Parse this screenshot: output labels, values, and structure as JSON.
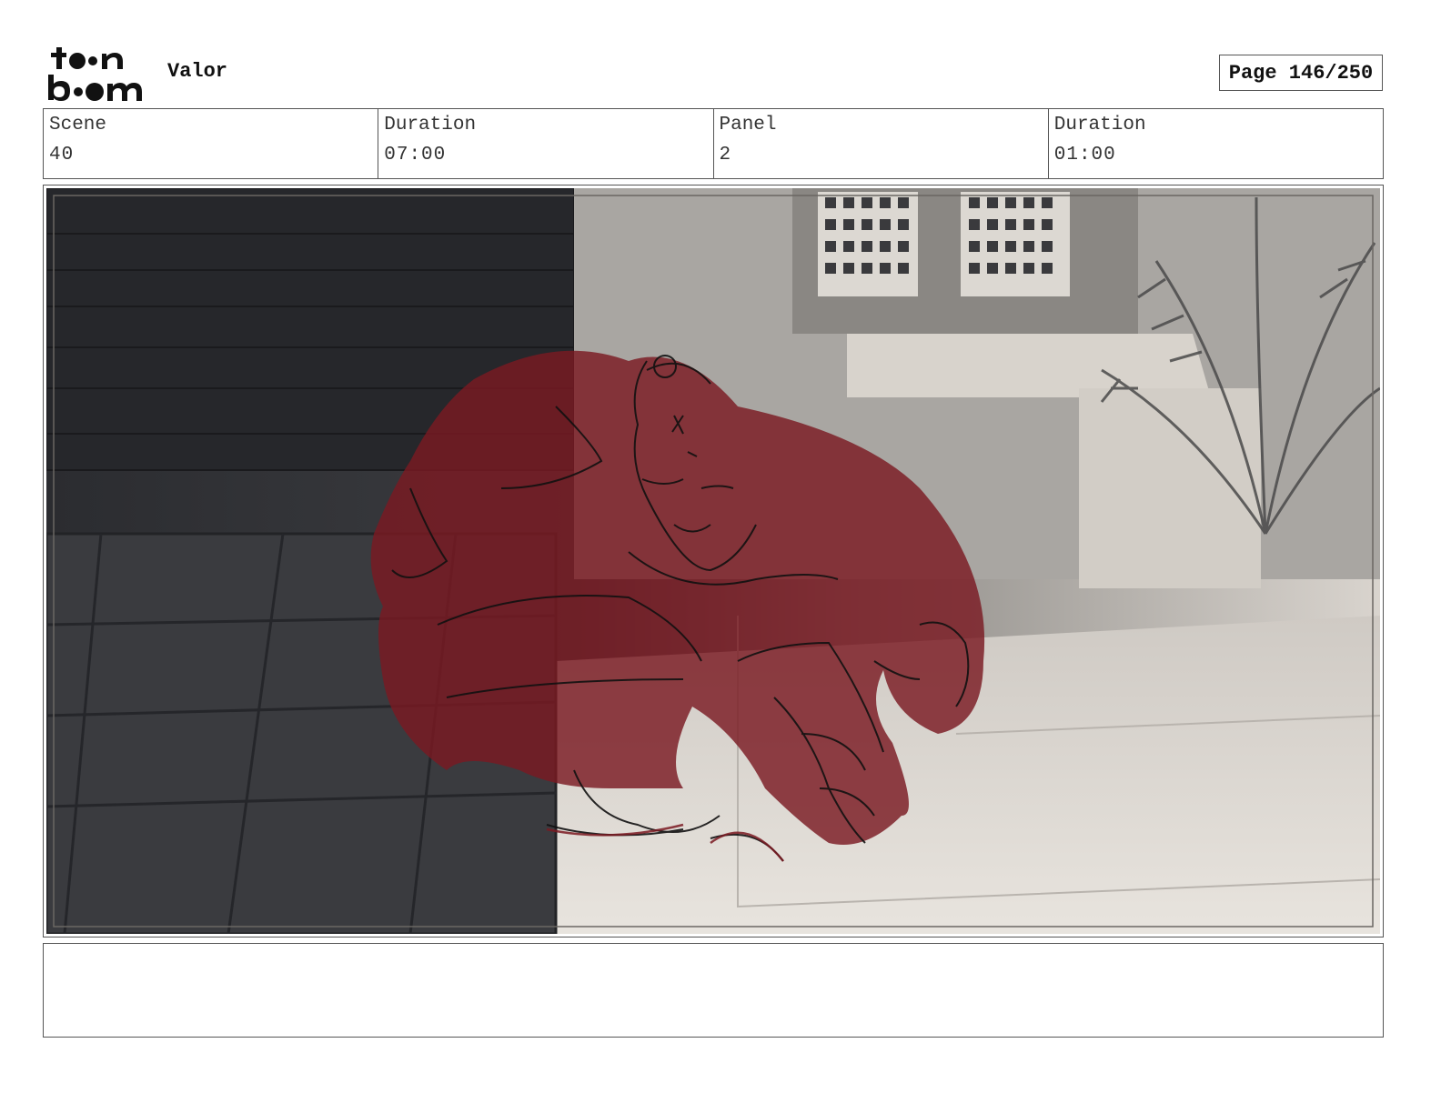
{
  "header": {
    "logo_text": "toon boom",
    "project_title": "Valor",
    "page_label": "Page 146/250"
  },
  "info": {
    "scene_label": "Scene",
    "scene_value": "40",
    "scene_duration_label": "Duration",
    "scene_duration_value": "07:00",
    "panel_label": "Panel",
    "panel_value": "2",
    "panel_duration_label": "Duration",
    "panel_duration_value": "01:00"
  },
  "notes": {
    "text": ""
  },
  "colors": {
    "sketch_fill": "#7a1a22",
    "border": "#555555"
  }
}
